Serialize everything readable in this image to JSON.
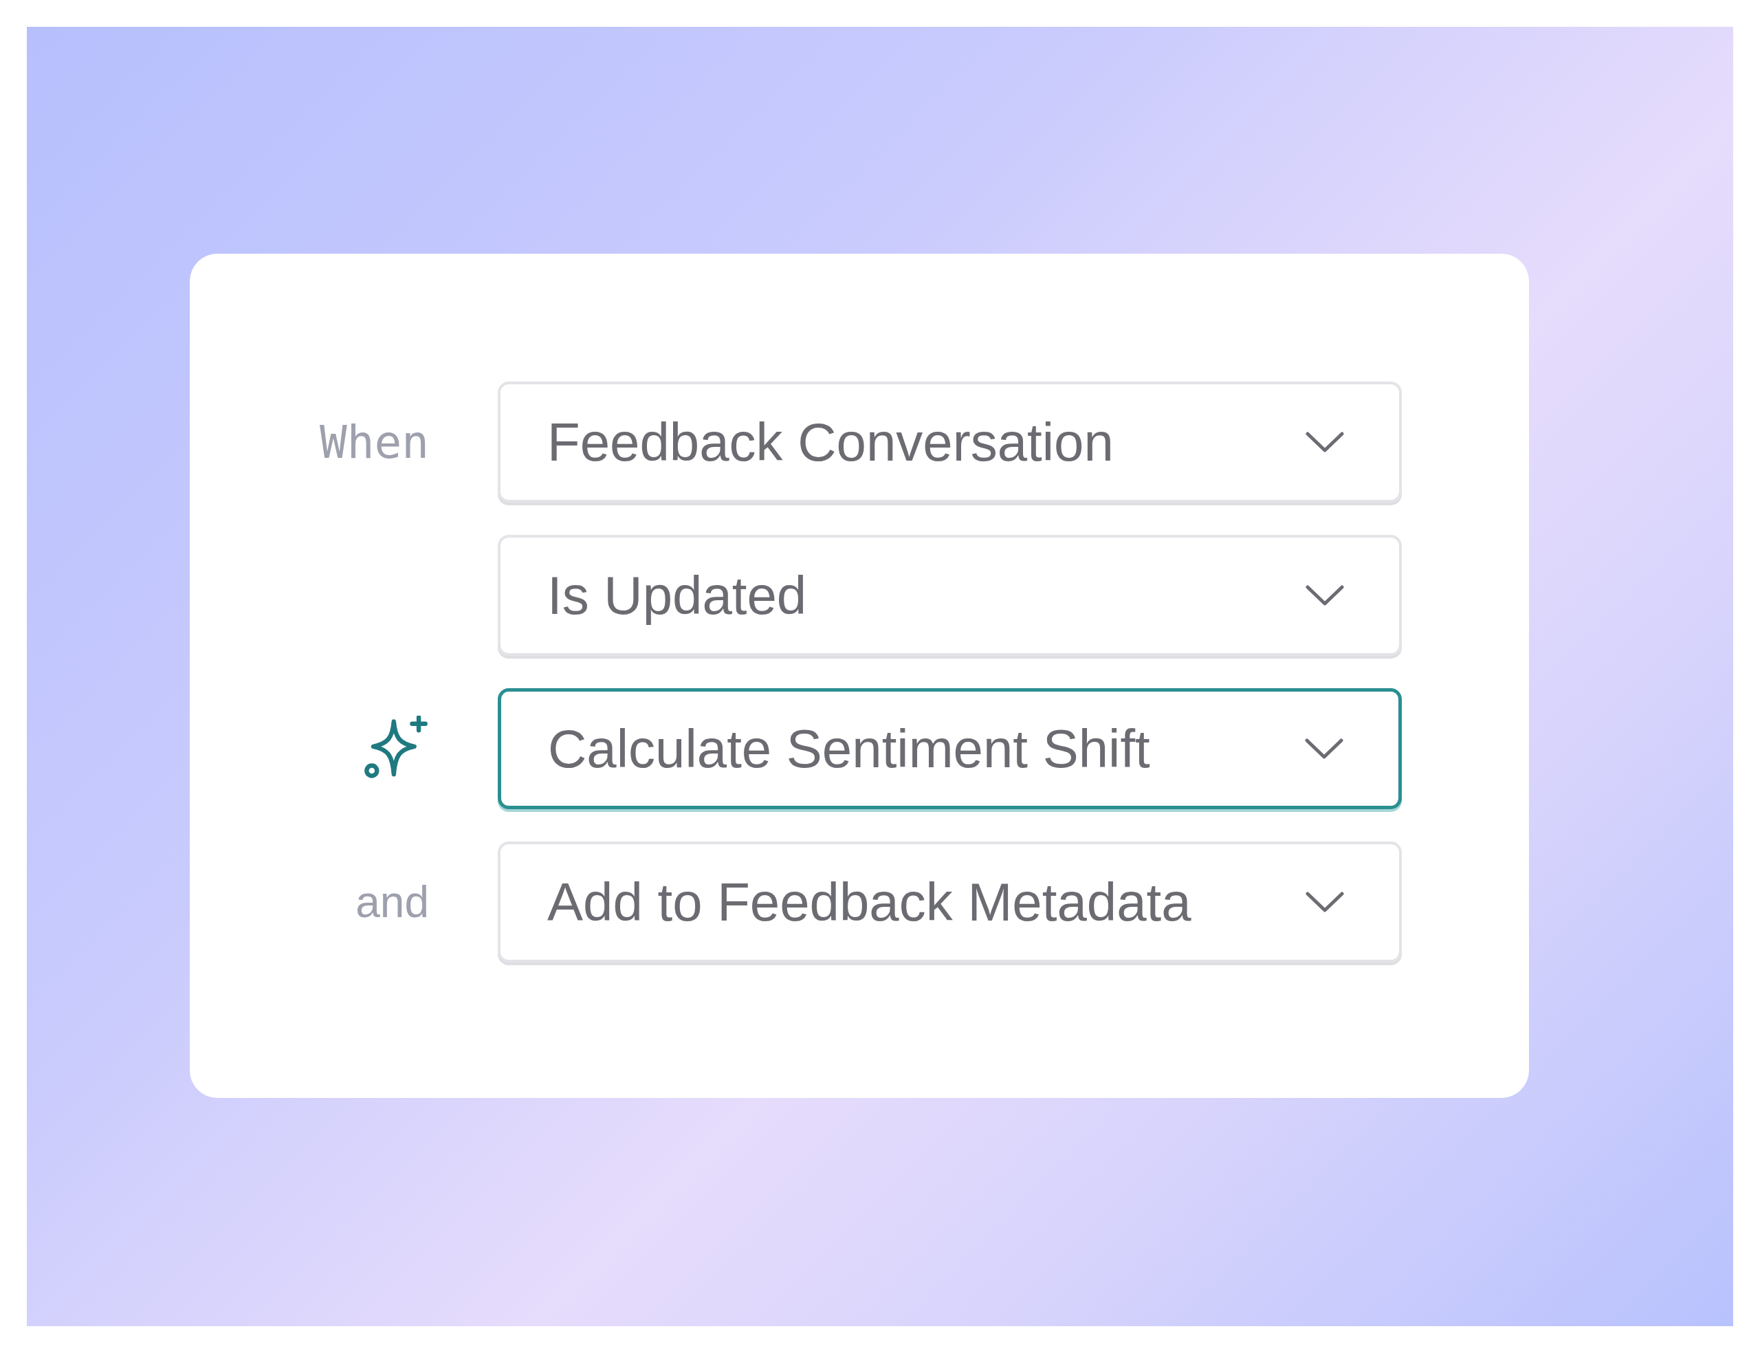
{
  "rows": [
    {
      "kind": "mono",
      "label": "When",
      "value": "Feedback Conversation",
      "selected": false
    },
    {
      "kind": "none",
      "value": "Is Updated",
      "selected": false
    },
    {
      "kind": "icon",
      "value": "Calculate Sentiment Shift",
      "selected": true
    },
    {
      "kind": "sans",
      "label": "and",
      "value": "Add to Feedback Metadata",
      "selected": false
    }
  ]
}
